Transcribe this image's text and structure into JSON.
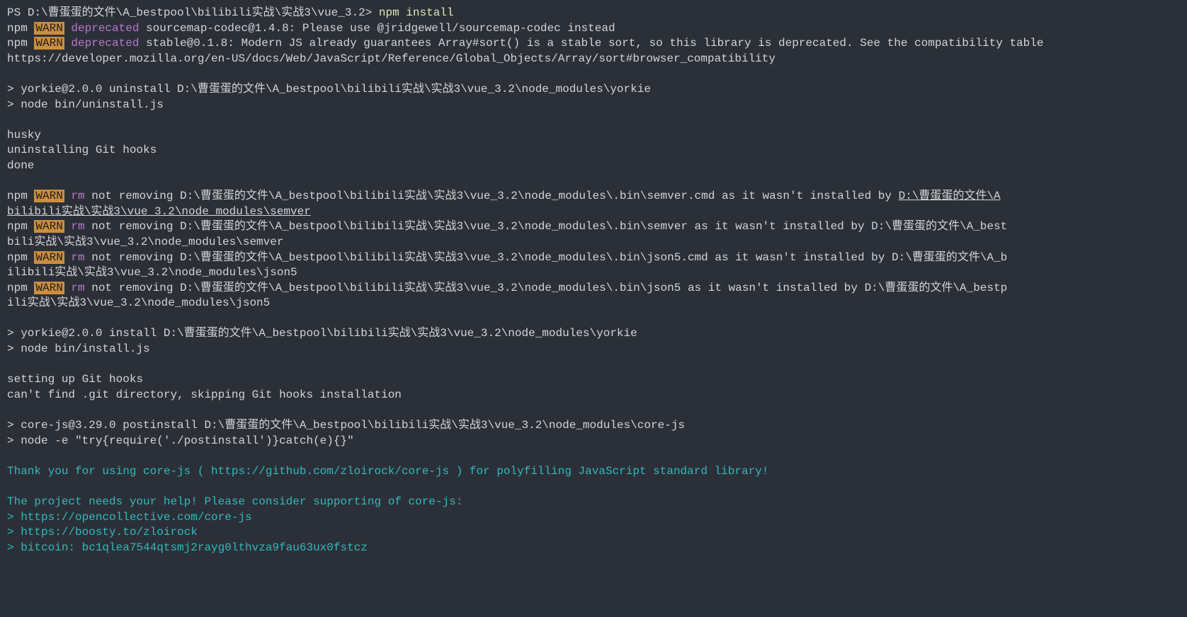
{
  "prompt": {
    "prefix": "PS ",
    "path": "D:\\曹蛋蛋的文件\\A_bestpool\\bilibili实战\\实战3\\vue_3.2>",
    "command": " npm install"
  },
  "warn1": {
    "npm": "npm ",
    "warn": "WARN",
    "deprecated": " deprecated",
    "rest": " sourcemap-codec@1.4.8: Please use @jridgewell/sourcemap-codec instead"
  },
  "warn2": {
    "npm": "npm ",
    "warn": "WARN",
    "deprecated": " deprecated",
    "rest": " stable@0.1.8: Modern JS already guarantees Array#sort() is a stable sort, so this library is deprecated. See the compatibility table"
  },
  "warn2b": "https://developer.mozilla.org/en-US/docs/Web/JavaScript/Reference/Global_Objects/Array/sort#browser_compatibility",
  "yorkie_uninstall": {
    "line1": "> yorkie@2.0.0 uninstall D:\\曹蛋蛋的文件\\A_bestpool\\bilibili实战\\实战3\\vue_3.2\\node_modules\\yorkie",
    "line2": "> node bin/uninstall.js"
  },
  "husky1": "husky",
  "husky2": "uninstalling Git hooks",
  "husky3": "done",
  "rm1": {
    "npm": "npm ",
    "warn": "WARN",
    "rm": " rm",
    "rest": " not removing D:\\曹蛋蛋的文件\\A_bestpool\\bilibili实战\\实战3\\vue_3.2\\node_modules\\.bin\\semver.cmd as it wasn't installed by ",
    "ul": "D:\\曹蛋蛋的文件\\A"
  },
  "rm1b": "bilibili实战\\实战3\\vue_3.2\\node_modules\\semver",
  "rm2": {
    "npm": "npm ",
    "warn": "WARN",
    "rm": " rm",
    "rest": " not removing D:\\曹蛋蛋的文件\\A_bestpool\\bilibili实战\\实战3\\vue_3.2\\node_modules\\.bin\\semver as it wasn't installed by D:\\曹蛋蛋的文件\\A_best"
  },
  "rm2b": "bili实战\\实战3\\vue_3.2\\node_modules\\semver",
  "rm3": {
    "npm": "npm ",
    "warn": "WARN",
    "rm": " rm",
    "rest": " not removing D:\\曹蛋蛋的文件\\A_bestpool\\bilibili实战\\实战3\\vue_3.2\\node_modules\\.bin\\json5.cmd as it wasn't installed by D:\\曹蛋蛋的文件\\A_b"
  },
  "rm3b": "ilibili实战\\实战3\\vue_3.2\\node_modules\\json5",
  "rm4": {
    "npm": "npm ",
    "warn": "WARN",
    "rm": " rm",
    "rest": " not removing D:\\曹蛋蛋的文件\\A_bestpool\\bilibili实战\\实战3\\vue_3.2\\node_modules\\.bin\\json5 as it wasn't installed by D:\\曹蛋蛋的文件\\A_bestp"
  },
  "rm4b": "ili实战\\实战3\\vue_3.2\\node_modules\\json5",
  "yorkie_install": {
    "line1": "> yorkie@2.0.0 install D:\\曹蛋蛋的文件\\A_bestpool\\bilibili实战\\实战3\\vue_3.2\\node_modules\\yorkie",
    "line2": "> node bin/install.js"
  },
  "git1": "setting up Git hooks",
  "git2": "can't find .git directory, skipping Git hooks installation",
  "corejs": {
    "line1": "> core-js@3.29.0 postinstall D:\\曹蛋蛋的文件\\A_bestpool\\bilibili实战\\实战3\\vue_3.2\\node_modules\\core-js",
    "line2": "> node -e \"try{require('./postinstall')}catch(e){}\""
  },
  "thank": "Thank you for using core-js ( https://github.com/zloirock/core-js ) for polyfilling JavaScript standard library!",
  "help": "The project needs your help! Please consider supporting of core-js:",
  "link1": "> https://opencollective.com/core-js",
  "link2": "> https://boosty.to/zloirock",
  "link3": "> bitcoin: bc1qlea7544qtsmj2rayg0lthvza9fau63ux0fstcz"
}
